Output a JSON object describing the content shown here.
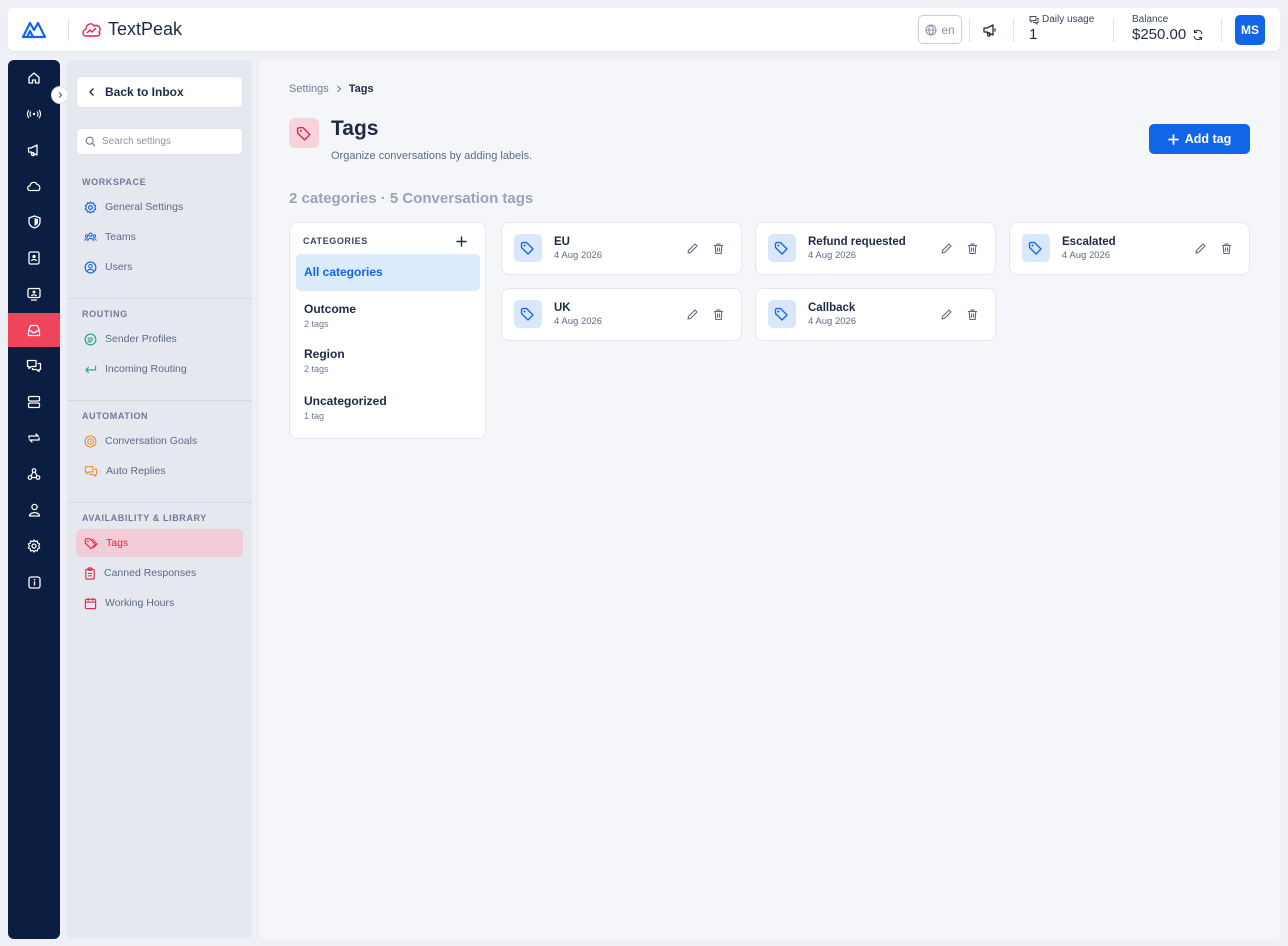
{
  "brand": {
    "name": "TextPeak"
  },
  "topbar": {
    "language": "en",
    "daily_usage_label": "Daily usage",
    "daily_usage_value": "1",
    "balance_label": "Balance",
    "balance_value": "$250.00",
    "avatar_initials": "MS"
  },
  "rail": {
    "items": [
      "home-icon",
      "broadcast-icon",
      "megaphone-icon",
      "cloud-icon",
      "shield-icon",
      "contact-book-icon",
      "contact-card-icon",
      "inbox-icon",
      "chat-icon",
      "server-icon",
      "transfer-icon",
      "webhook-icon",
      "user-icon",
      "gear-icon",
      "info-icon"
    ],
    "active": "inbox-icon"
  },
  "sidebar": {
    "back_label": "Back to Inbox",
    "search_placeholder": "Search settings",
    "sections": [
      {
        "title": "WORKSPACE",
        "items": [
          {
            "label": "General Settings",
            "icon": "gear-icon"
          },
          {
            "label": "Teams",
            "icon": "team-icon"
          },
          {
            "label": "Users",
            "icon": "user-circle-icon"
          }
        ]
      },
      {
        "title": "ROUTING",
        "items": [
          {
            "label": "Sender Profiles",
            "icon": "sender-icon"
          },
          {
            "label": "Incoming Routing",
            "icon": "return-arrow-icon"
          }
        ]
      },
      {
        "title": "AUTOMATION",
        "items": [
          {
            "label": "Conversation Goals",
            "icon": "target-icon"
          },
          {
            "label": "Auto Replies",
            "icon": "chat-bubbles-icon"
          }
        ]
      },
      {
        "title": "AVAILABILITY & LIBRARY",
        "items": [
          {
            "label": "Tags",
            "icon": "tag-icon",
            "active": true
          },
          {
            "label": "Canned Responses",
            "icon": "clipboard-icon"
          },
          {
            "label": "Working Hours",
            "icon": "calendar-icon"
          }
        ]
      }
    ]
  },
  "main": {
    "breadcrumb": [
      "Settings",
      "Tags"
    ],
    "title": "Tags",
    "subtitle": "Organize conversations by adding labels.",
    "add_button": "Add tag",
    "summary": "2 categories · 5 Conversation tags",
    "categories_header": "CATEGORIES",
    "categories": [
      {
        "name": "All categories",
        "count": "",
        "active": true
      },
      {
        "name": "Outcome",
        "count": "2 tags"
      },
      {
        "name": "Region",
        "count": "2 tags"
      },
      {
        "name": "Uncategorized",
        "count": "1 tag"
      }
    ],
    "tags": [
      {
        "name": "EU",
        "date": "4 Aug 2026"
      },
      {
        "name": "Refund requested",
        "date": "4 Aug 2026"
      },
      {
        "name": "Escalated",
        "date": "4 Aug 2026"
      },
      {
        "name": "UK",
        "date": "4 Aug 2026"
      },
      {
        "name": "Callback",
        "date": "4 Aug 2026"
      }
    ]
  },
  "colors": {
    "accent": "#1166e8",
    "danger": "#f0435c",
    "rail": "#0b1d40",
    "tag_active_bg": "#f2cdd8"
  }
}
